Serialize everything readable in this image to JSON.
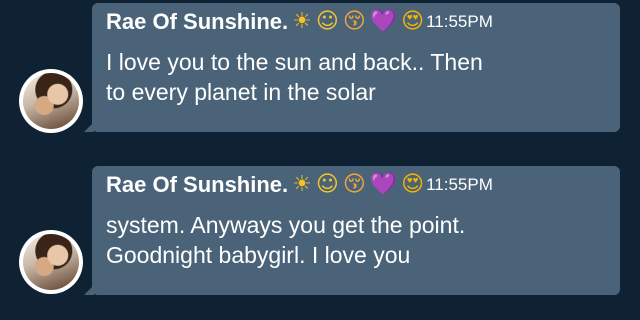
{
  "messages": [
    {
      "sender": "Rae Of Sunshine.",
      "emojis": [
        "☀",
        "☺",
        "😚",
        "💜",
        "😍"
      ],
      "time": "11:55PM",
      "text": "I love you to the sun and back.. Then\nto every planet in the solar"
    },
    {
      "sender": "Rae Of Sunshine.",
      "emojis": [
        "☀",
        "☺",
        "😚",
        "💜",
        "😍"
      ],
      "time": "11:55PM",
      "text": "system. Anyways you get the point.\nGoodnight babygirl. I love you"
    }
  ],
  "colors": {
    "background": "#0f2234",
    "bubble": "#4a6378",
    "text": "#ffffff"
  }
}
